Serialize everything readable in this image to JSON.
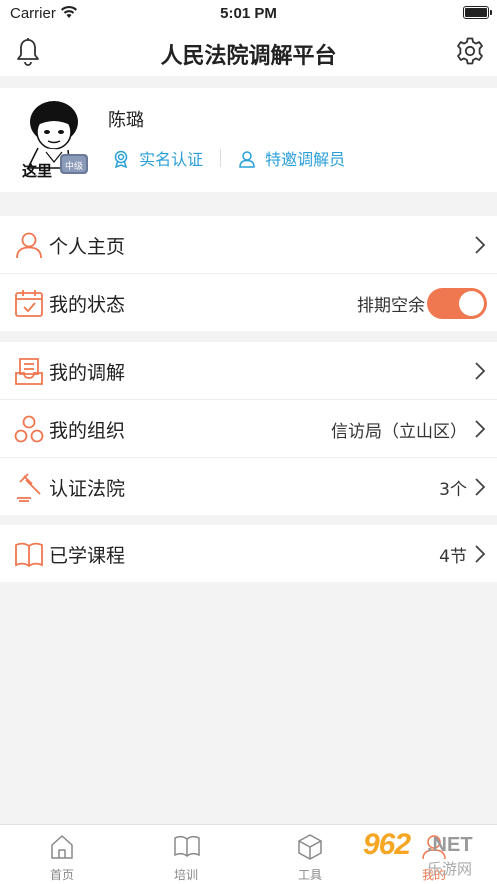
{
  "status_bar": {
    "carrier": "Carrier",
    "time": "5:01 PM"
  },
  "header": {
    "title": "人民法院调解平台",
    "left_icon": "bell-icon",
    "right_icon": "gear-icon"
  },
  "profile": {
    "name": "陈璐",
    "avatar_caption": "这里",
    "avatar_badge": "中级",
    "badges": [
      {
        "label": "实名认证",
        "icon": "certified-icon"
      },
      {
        "label": "特邀调解员",
        "icon": "person-icon"
      }
    ]
  },
  "menu_group1": [
    {
      "label": "个人主页",
      "icon": "person-icon",
      "value": ""
    },
    {
      "label": "我的状态",
      "icon": "calendar-icon",
      "value": "排期空余",
      "toggle_on": true
    }
  ],
  "menu_group2": [
    {
      "label": "我的调解",
      "icon": "document-icon",
      "value": ""
    },
    {
      "label": "我的组织",
      "icon": "organization-icon",
      "value": "信访局（立山区）"
    },
    {
      "label": "认证法院",
      "icon": "gavel-icon",
      "value": "3个"
    }
  ],
  "menu_group3": [
    {
      "label": "已学课程",
      "icon": "book-icon",
      "value": "4节"
    }
  ],
  "tabbar": [
    {
      "label": "首页",
      "icon": "home-icon"
    },
    {
      "label": "培训",
      "icon": "book-icon"
    },
    {
      "label": "工具",
      "icon": "cube-icon"
    },
    {
      "label": "我的",
      "icon": "user-icon",
      "active": true
    }
  ],
  "watermark": {
    "number": "962",
    "suffix": ".NET",
    "cn": "乐游网"
  },
  "colors": {
    "accent": "#f07850",
    "link": "#2aa0d8",
    "background": "#f3f3f3"
  }
}
